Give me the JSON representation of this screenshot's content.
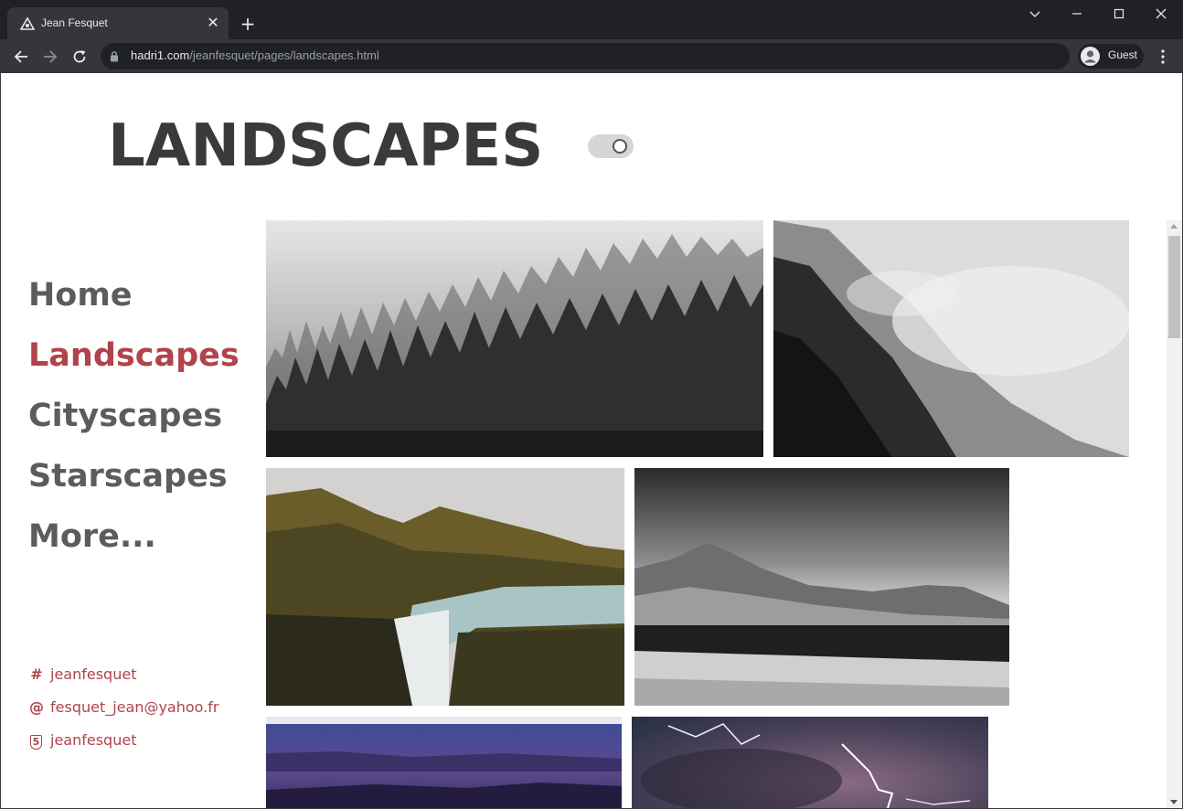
{
  "browser": {
    "tab_title": "Jean Fesquet",
    "tab_close": "✕",
    "new_tab": "+",
    "url_host": "hadri1.com",
    "url_path": "/jeanfesquet/pages/landscapes.html",
    "profile_label": "Guest"
  },
  "page": {
    "title": "LANDSCAPES",
    "nav": [
      {
        "label": "Home",
        "active": false
      },
      {
        "label": "Landscapes",
        "active": true
      },
      {
        "label": "Cityscapes",
        "active": false
      },
      {
        "label": "Starscapes",
        "active": false
      },
      {
        "label": "More...",
        "active": false
      }
    ],
    "socials": [
      {
        "icon": "hash-icon",
        "glyph": "#",
        "label": "jeanfesquet"
      },
      {
        "icon": "at-icon",
        "glyph": "@",
        "label": "fesquet_jean@yahoo.fr"
      },
      {
        "icon": "html5-icon",
        "glyph": "5",
        "label": "jeanfesquet"
      }
    ],
    "accent_color": "#b0434b",
    "text_color": "#5c5c5c",
    "toggle_on": false,
    "photos": [
      {
        "subject": "foggy forest",
        "tone": "monochrome"
      },
      {
        "subject": "misty mountain cliff",
        "tone": "monochrome"
      },
      {
        "subject": "waterfall river",
        "tone": "color"
      },
      {
        "subject": "desert volcano lake",
        "tone": "monochrome"
      },
      {
        "subject": "twilight lake",
        "tone": "color"
      },
      {
        "subject": "lightning storm",
        "tone": "color"
      }
    ]
  }
}
